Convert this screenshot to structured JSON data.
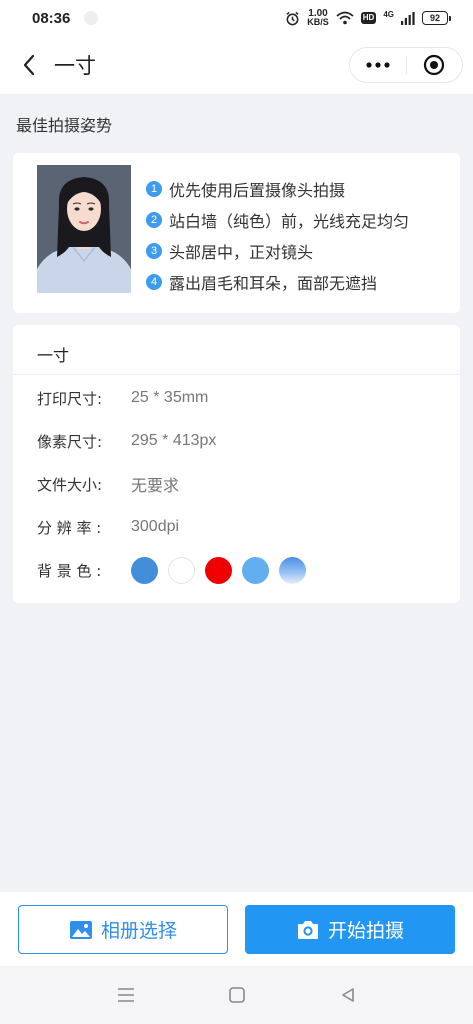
{
  "status": {
    "time": "08:36",
    "speed_value": "1.00",
    "speed_unit": "KB/S",
    "hd": "HD",
    "network": "4G",
    "battery": "92"
  },
  "nav": {
    "title": "一寸"
  },
  "section_title": "最佳拍摄姿势",
  "tips": [
    {
      "num": "1",
      "text": "优先使用后置摄像头拍摄"
    },
    {
      "num": "2",
      "text": "站白墙（纯色）前，光线充足均匀"
    },
    {
      "num": "3",
      "text": "头部居中，正对镜头"
    },
    {
      "num": "4",
      "text": "露出眉毛和耳朵，面部无遮挡"
    }
  ],
  "spec": {
    "title": "一寸",
    "rows": [
      {
        "label": "打印尺寸:",
        "value": "25 * 35mm"
      },
      {
        "label": "像素尺寸:",
        "value": "295 * 413px"
      },
      {
        "label": "文件大小:",
        "value": "无要求"
      },
      {
        "label": "分 辨 率 :",
        "value": "300dpi"
      }
    ],
    "background_label": "背 景 色 :",
    "background_colors": [
      "#438edb",
      "#ffffff",
      "#f00000",
      "#63aef0",
      "#5c9ded"
    ]
  },
  "buttons": {
    "album": "相册选择",
    "shoot": "开始拍摄"
  },
  "colors": {
    "primary": "#2196f3",
    "tip_badge": "#3d9bf0"
  }
}
